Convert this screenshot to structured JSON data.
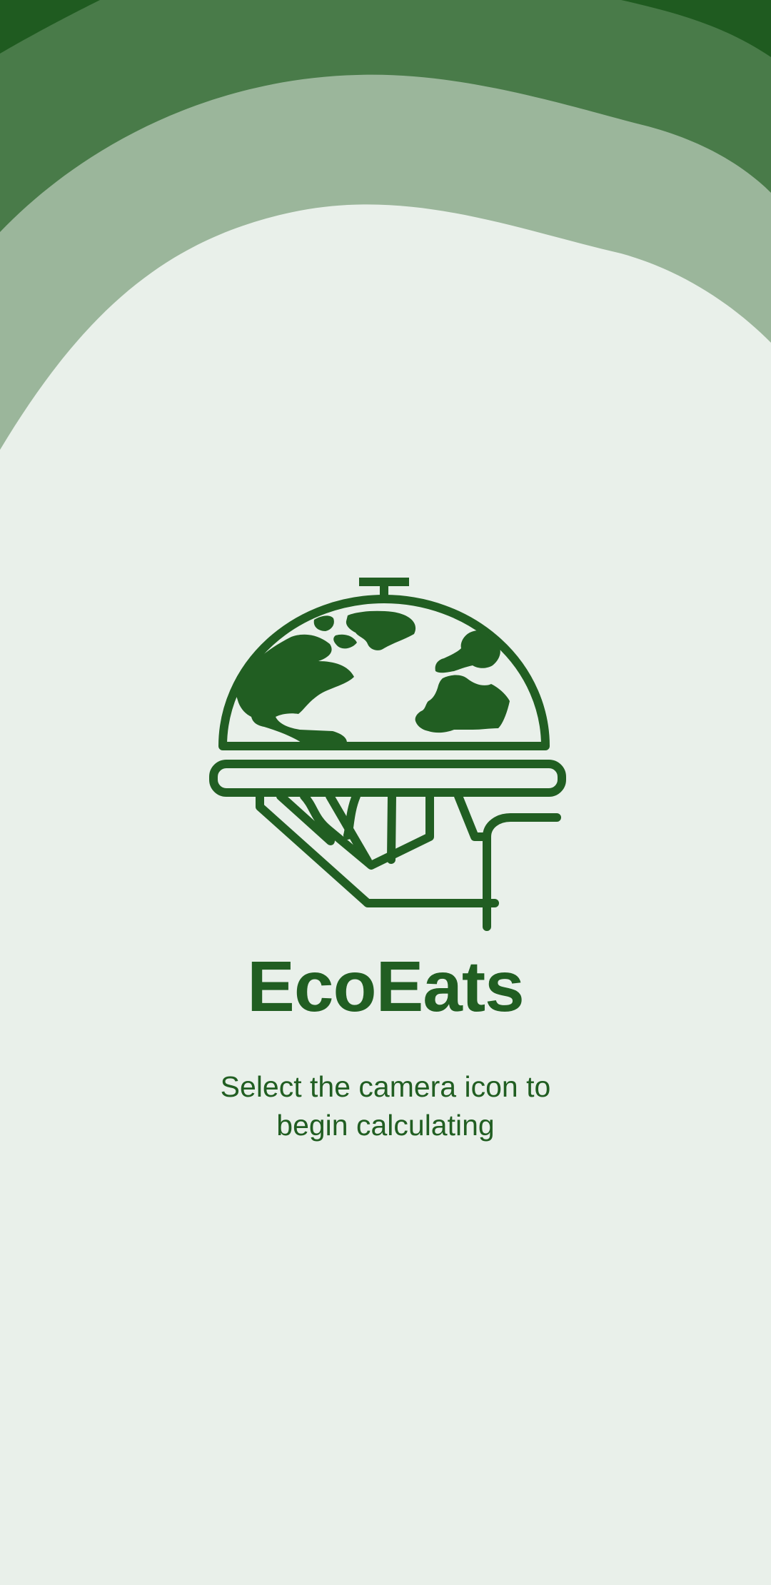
{
  "app": {
    "title": "EcoEats",
    "subtitle": "Select the camera icon to begin calculating"
  },
  "logo": {
    "icon": "globe-cloche-serving-hand-icon"
  },
  "colors": {
    "background": "#e9f0ea",
    "wave_dark": "#1f5b20",
    "wave_mid": "#497b49",
    "wave_light": "#9bb69b",
    "brand_green": "#215e22"
  }
}
